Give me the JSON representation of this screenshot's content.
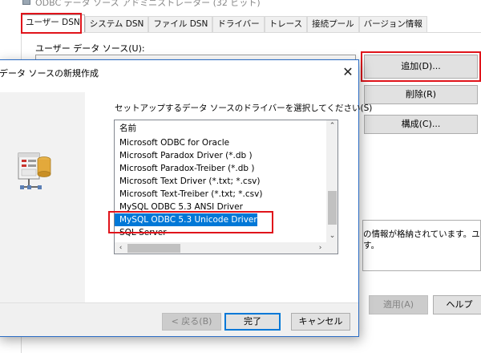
{
  "odbc_admin": {
    "title": "ODBC データ ソース アドミニストレーター (32 ビット)",
    "tabs": [
      {
        "label": "ユーザー DSN",
        "active": true
      },
      {
        "label": "システム DSN",
        "active": false
      },
      {
        "label": "ファイル DSN",
        "active": false
      },
      {
        "label": "ドライバー",
        "active": false
      },
      {
        "label": "トレース",
        "active": false
      },
      {
        "label": "接続プール",
        "active": false
      },
      {
        "label": "バージョン情報",
        "active": false
      }
    ],
    "data_sources_label": "ユーザー データ ソース(U):",
    "buttons": {
      "add": "追加(D)...",
      "remove": "削除(R)",
      "configure": "構成(C)...",
      "apply": "適用(A)",
      "help": "ヘルプ"
    },
    "info_line1": "の情報が格納されています。ユーザ",
    "info_line2": "す。"
  },
  "dialog": {
    "title": "データ ソースの新規作成",
    "close_glyph": "✕",
    "prompt": "セットアップするデータ ソースのドライバーを選択してください(S)",
    "list_header": "名前",
    "drivers": [
      "Microsoft ODBC for Oracle",
      "Microsoft Paradox Driver (*.db )",
      "Microsoft Paradox-Treiber (*.db )",
      "Microsoft Text Driver (*.txt; *.csv)",
      "Microsoft Text-Treiber (*.txt; *.csv)",
      "MySQL ODBC 5.3 ANSI Driver",
      "MySQL ODBC 5.3 Unicode Driver",
      "SQL Server"
    ],
    "selected_driver": "MySQL ODBC 5.3 Unicode Driver",
    "buttons": {
      "back": "< 戻る(B)",
      "finish": "完了",
      "cancel": "キャンセル"
    },
    "scroll_glyphs": {
      "up": "⌃",
      "down": "⌄",
      "left": "‹",
      "right": "›"
    }
  },
  "colors": {
    "highlight_red": "#e0141b",
    "selection_blue": "#0078d7",
    "button_face": "#e1e1e1"
  },
  "icons": [
    "odbc-app-icon",
    "database-wizard-icon",
    "close-icon",
    "scroll-up-icon",
    "scroll-down-icon",
    "scroll-left-icon",
    "scroll-right-icon"
  ]
}
